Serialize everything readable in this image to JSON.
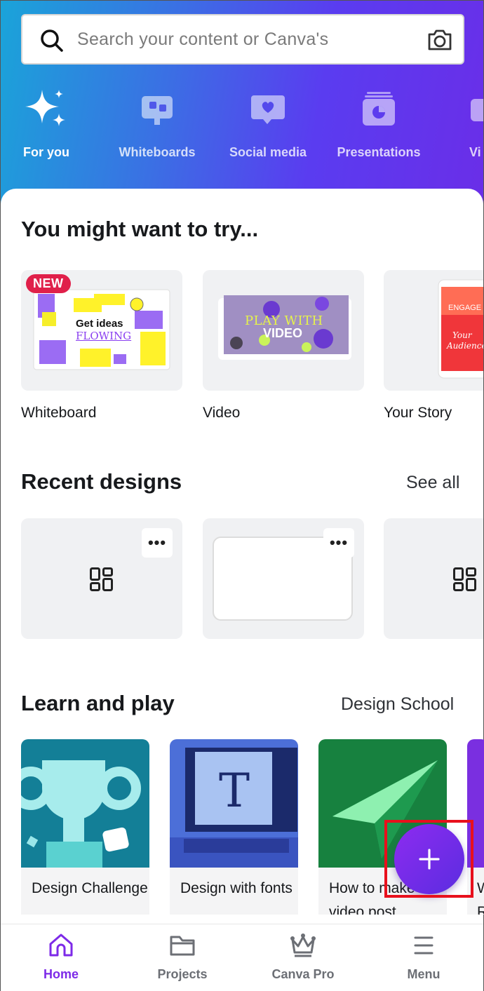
{
  "search": {
    "placeholder": "Search your content or Canva's"
  },
  "categories": [
    {
      "label": "For you",
      "icon": "sparkle-icon",
      "active": true
    },
    {
      "label": "Whiteboards",
      "icon": "whiteboard-icon"
    },
    {
      "label": "Social media",
      "icon": "heart-bubble-icon"
    },
    {
      "label": "Presentations",
      "icon": "presentation-icon"
    },
    {
      "label": "Vi",
      "icon": "video-icon"
    }
  ],
  "try_section": {
    "title": "You might want to try...",
    "badge": "NEW",
    "items": [
      {
        "label": "Whiteboard",
        "thumb_text": [
          "Get ideas",
          "FLOWING"
        ]
      },
      {
        "label": "Video",
        "thumb_text": [
          "PLAY WITH",
          "VIDEO"
        ]
      },
      {
        "label": "Your Story",
        "thumb_text": [
          "ENGAGE",
          "Your",
          "Audience"
        ]
      }
    ]
  },
  "recent_section": {
    "title": "Recent designs",
    "see_all": "See all",
    "more_label": "•••"
  },
  "learn_section": {
    "title": "Learn and play",
    "link": "Design School",
    "cards": [
      {
        "caption": "Design Challenge"
      },
      {
        "caption": "Design with fonts"
      },
      {
        "caption": "How to make video post"
      },
      {
        "caption": "W R"
      }
    ]
  },
  "fab": {
    "icon": "plus-icon"
  },
  "colors": {
    "accent": "#7d2ae8",
    "highlight": "#e8101c",
    "badge": "#e0204a"
  },
  "bottom_nav": [
    {
      "label": "Home",
      "icon": "home-icon",
      "active": true
    },
    {
      "label": "Projects",
      "icon": "folder-icon"
    },
    {
      "label": "Canva Pro",
      "icon": "crown-icon"
    },
    {
      "label": "Menu",
      "icon": "hamburger-icon"
    }
  ]
}
